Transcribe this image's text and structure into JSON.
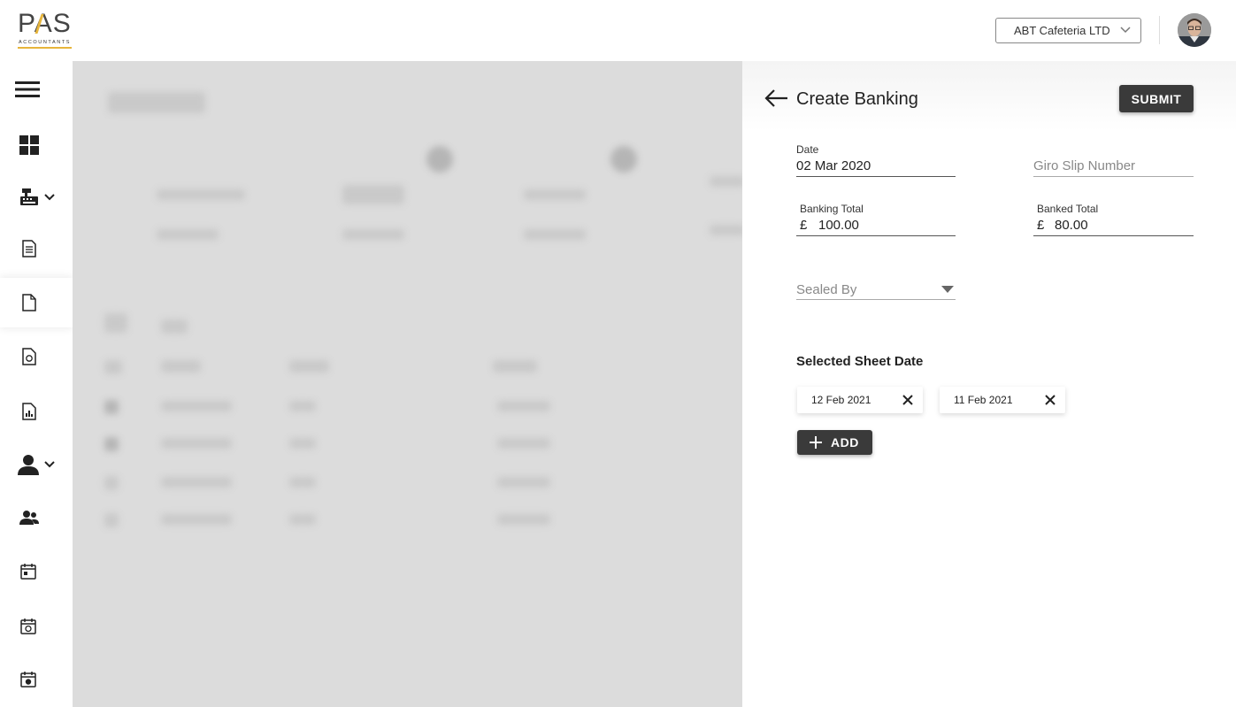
{
  "header": {
    "logo_text": "PAS",
    "logo_subtext": "ACCOUNTANTS",
    "company_select": "ABT Cafeteria LTD"
  },
  "sidebar": {
    "items": [
      {
        "icon": "menu-icon"
      },
      {
        "icon": "dashboard-icon"
      },
      {
        "icon": "cash-register-icon"
      },
      {
        "icon": "document-list-icon"
      },
      {
        "icon": "document-icon"
      },
      {
        "icon": "document-money-icon"
      },
      {
        "icon": "report-icon"
      },
      {
        "icon": "user-icon"
      },
      {
        "icon": "users-icon"
      },
      {
        "icon": "calendar-icon"
      },
      {
        "icon": "calendar-check-icon"
      },
      {
        "icon": "calendar-settings-icon"
      }
    ]
  },
  "panel": {
    "title": "Create Banking",
    "submit_label": "SUBMIT",
    "date": {
      "label": "Date",
      "value": "02 Mar 2020"
    },
    "giro": {
      "placeholder": "Giro Slip Number"
    },
    "banking_total": {
      "label": "Banking Total",
      "currency": "£",
      "value": "100.00"
    },
    "banked_total": {
      "label": "Banked Total",
      "currency": "£",
      "value": "80.00"
    },
    "sealed_by": {
      "placeholder": "Sealed By"
    },
    "selected_sheet_title": "Selected Sheet Date",
    "chips": [
      "12 Feb 2021",
      "11 Feb 2021"
    ],
    "add_label": "ADD"
  },
  "colors": {
    "accent": "#e7b53b",
    "button_dark": "#3a3a3a",
    "overlay": "#dcdcdc"
  }
}
